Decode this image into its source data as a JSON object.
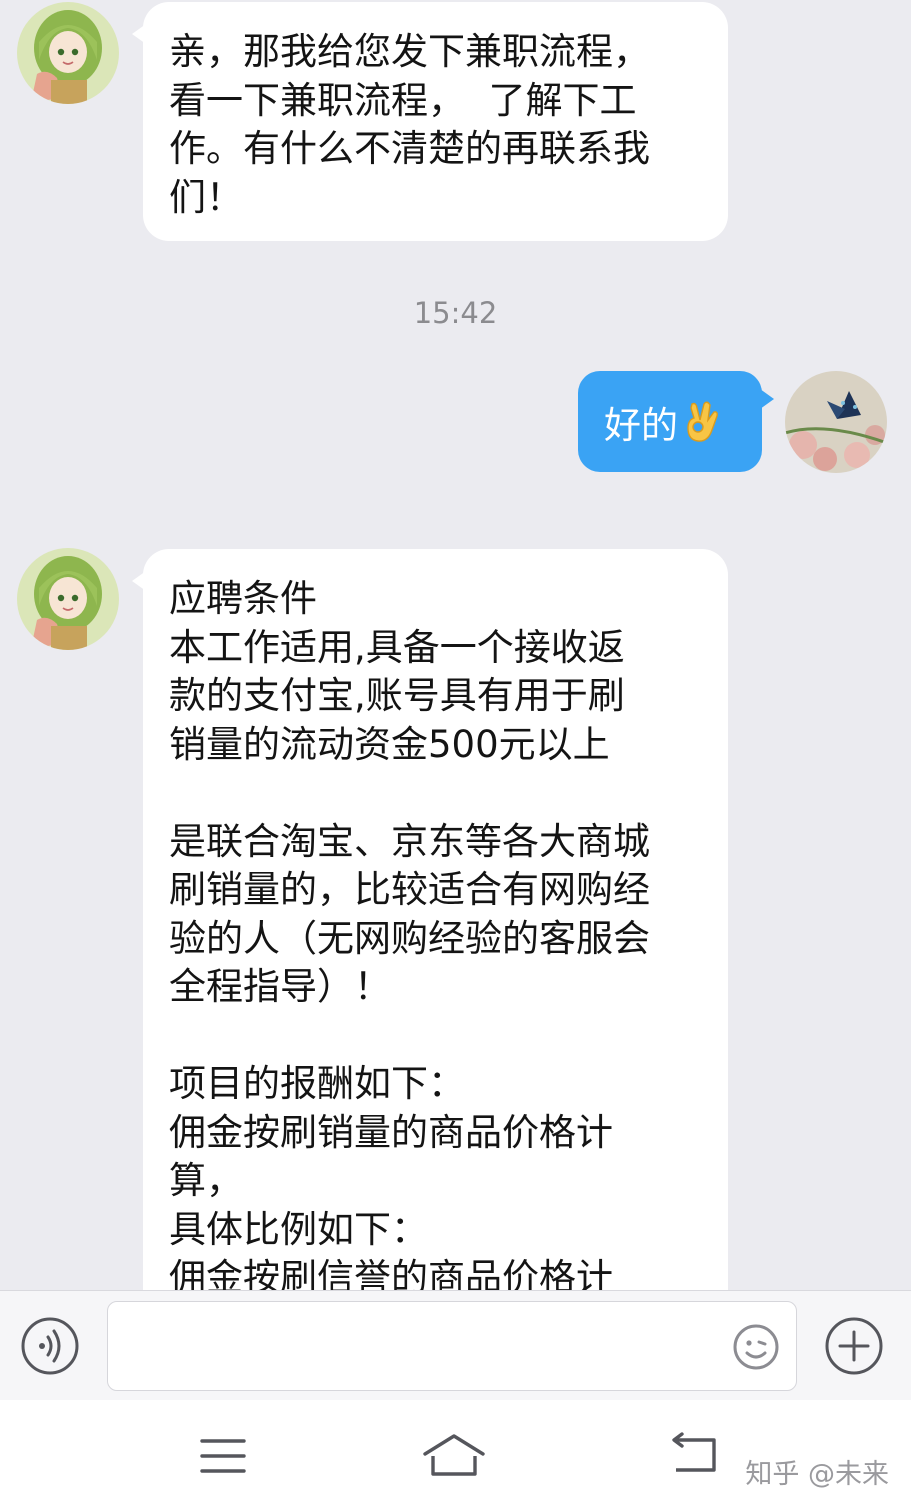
{
  "messages": [
    {
      "side": "in",
      "text": "亲，那我给您发下兼职流程，\n看一下兼职流程，  了解下工\n作。有什么不清楚的再联系我\n们！"
    },
    {
      "side": "out",
      "text": "好的"
    },
    {
      "side": "in",
      "text": "应聘条件\n本工作适用,具备一个接收返\n款的支付宝,账号具有用于刷\n销量的流动资金500元以上\n\n是联合淘宝、京东等各大商城\n刷销量的，比较适合有网购经\n验的人（无网购经验的客服会\n全程指导）！\n\n项目的报酬如下：\n佣金按刷销量的商品价格计\n算，\n具体比例如下：\n佣金按刷信誉的商品价格计"
    }
  ],
  "timestamp": "15:42",
  "input": {
    "value": "",
    "placeholder": ""
  },
  "icons": {
    "voice": "voice-icon",
    "emoji": "emoji-icon",
    "plus": "plus-icon",
    "ok_emoji": "ok-hand-icon",
    "nav_menu": "menu-icon",
    "nav_home": "home-icon",
    "nav_back": "back-icon"
  },
  "watermark": "知乎 @未来",
  "colors": {
    "bubble_out": "#3aa3f4",
    "bubble_in": "#ffffff",
    "background": "#ebebf0"
  }
}
